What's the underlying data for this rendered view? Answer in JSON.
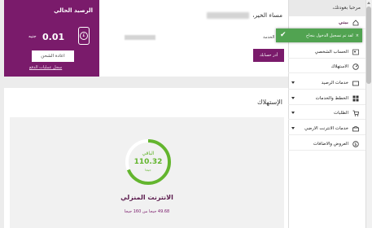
{
  "sidebar": {
    "greeting": "مرحبا بعودتك،",
    "items": [
      {
        "label": "بيتي",
        "icon": "home-icon",
        "active": true
      },
      {
        "label": "الحساب الشخصي",
        "icon": "user-icon"
      },
      {
        "label": "الاستهلاك",
        "icon": "gauge-icon"
      },
      {
        "label": "خدمات الرصيد",
        "icon": "wallet-icon",
        "expandable": true
      },
      {
        "label": "الخطط والخدمات",
        "icon": "grid-icon",
        "expandable": true
      },
      {
        "label": "الطلبات",
        "icon": "cart-icon",
        "expandable": true
      },
      {
        "label": "خدمات الانترنت الارضي",
        "icon": "phone-icon",
        "expandable": true
      },
      {
        "label": "العروض والاضافات",
        "icon": "offers-icon"
      }
    ]
  },
  "toast": {
    "message": "لقد تم تسجيل الدخول بنجاح",
    "close": "×",
    "color": "#51a351"
  },
  "balance": {
    "title": "الرصيد الحالي",
    "amount": "0.01",
    "currency": "جنيه",
    "currency_symbol": "£",
    "recharge_label": "اعادة الشحن",
    "payments_link": "سجل عمليات الدفع"
  },
  "account": {
    "welcome": "مساء الخير،",
    "service_label": "رقم الخدمة",
    "manage_label": "أدر حسابك"
  },
  "consumption": {
    "title": "الإستهلاك",
    "remaining_label": "الباقي",
    "remaining_value": "110.32",
    "remaining_unit": "جيجا",
    "used_fraction": 0.3105,
    "service_name": "الانترنت المنزلي",
    "usage_text": "49.68 جيجا من 160 جيجا"
  },
  "colors": {
    "brand": "#7a1b6b",
    "gauge": "#63b52e",
    "gauge_track": "#ffffff"
  }
}
